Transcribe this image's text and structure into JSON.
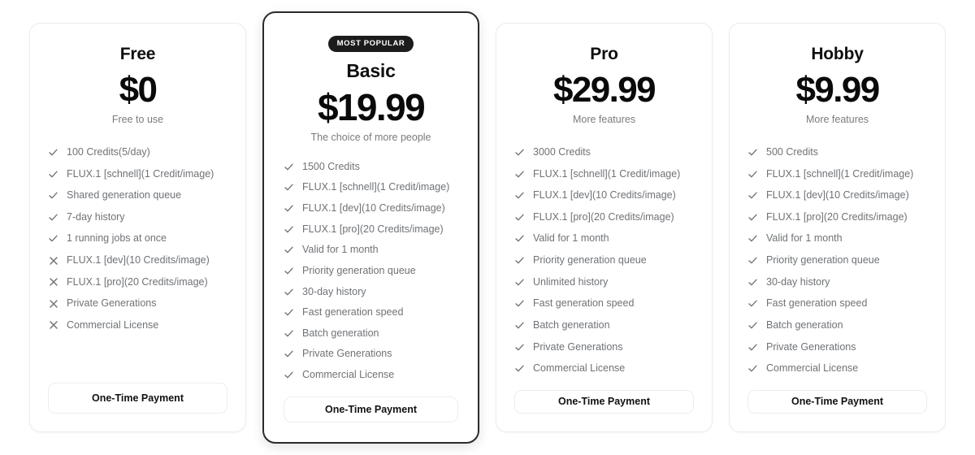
{
  "colors": {
    "badge_background": "#1c1c1c",
    "badge_text": "#ffffff",
    "featured_border": "#2b2b2b",
    "card_border": "#ececec",
    "price_text": "#0a0a0a",
    "feature_text": "#6f7276",
    "tagline_text": "#7b7b7b",
    "page_background": "#ffffff"
  },
  "plans": [
    {
      "name": "Free",
      "price": "$0",
      "tagline": "Free to use",
      "featured": false,
      "badge": "",
      "cta_label": "One-Time Payment",
      "features": [
        {
          "text": "100 Credits(5/day)",
          "included": true
        },
        {
          "text": "FLUX.1 [schnell](1 Credit/image)",
          "included": true
        },
        {
          "text": "Shared generation queue",
          "included": true
        },
        {
          "text": "7-day history",
          "included": true
        },
        {
          "text": "1 running jobs at once",
          "included": true
        },
        {
          "text": "FLUX.1 [dev](10 Credits/image)",
          "included": false
        },
        {
          "text": "FLUX.1 [pro](20 Credits/image)",
          "included": false
        },
        {
          "text": "Private Generations",
          "included": false
        },
        {
          "text": "Commercial License",
          "included": false
        }
      ]
    },
    {
      "name": "Basic",
      "price": "$19.99",
      "tagline": "The choice of more people",
      "featured": true,
      "badge": "MOST POPULAR",
      "cta_label": "One-Time Payment",
      "features": [
        {
          "text": "1500 Credits",
          "included": true
        },
        {
          "text": "FLUX.1 [schnell](1 Credit/image)",
          "included": true
        },
        {
          "text": "FLUX.1 [dev](10 Credits/image)",
          "included": true
        },
        {
          "text": "FLUX.1 [pro](20 Credits/image)",
          "included": true
        },
        {
          "text": "Valid for 1 month",
          "included": true
        },
        {
          "text": "Priority generation queue",
          "included": true
        },
        {
          "text": "30-day history",
          "included": true
        },
        {
          "text": "Fast generation speed",
          "included": true
        },
        {
          "text": "Batch generation",
          "included": true
        },
        {
          "text": "Private Generations",
          "included": true
        },
        {
          "text": "Commercial License",
          "included": true
        }
      ]
    },
    {
      "name": "Pro",
      "price": "$29.99",
      "tagline": "More features",
      "featured": false,
      "badge": "",
      "cta_label": "One-Time Payment",
      "features": [
        {
          "text": "3000 Credits",
          "included": true
        },
        {
          "text": "FLUX.1 [schnell](1 Credit/image)",
          "included": true
        },
        {
          "text": "FLUX.1 [dev](10 Credits/image)",
          "included": true
        },
        {
          "text": "FLUX.1 [pro](20 Credits/image)",
          "included": true
        },
        {
          "text": "Valid for 1 month",
          "included": true
        },
        {
          "text": "Priority generation queue",
          "included": true
        },
        {
          "text": "Unlimited history",
          "included": true
        },
        {
          "text": "Fast generation speed",
          "included": true
        },
        {
          "text": "Batch generation",
          "included": true
        },
        {
          "text": "Private Generations",
          "included": true
        },
        {
          "text": "Commercial License",
          "included": true
        }
      ]
    },
    {
      "name": "Hobby",
      "price": "$9.99",
      "tagline": "More features",
      "featured": false,
      "badge": "",
      "cta_label": "One-Time Payment",
      "features": [
        {
          "text": "500 Credits",
          "included": true
        },
        {
          "text": "FLUX.1 [schnell](1 Credit/image)",
          "included": true
        },
        {
          "text": "FLUX.1 [dev](10 Credits/image)",
          "included": true
        },
        {
          "text": "FLUX.1 [pro](20 Credits/image)",
          "included": true
        },
        {
          "text": "Valid for 1 month",
          "included": true
        },
        {
          "text": "Priority generation queue",
          "included": true
        },
        {
          "text": "30-day history",
          "included": true
        },
        {
          "text": "Fast generation speed",
          "included": true
        },
        {
          "text": "Batch generation",
          "included": true
        },
        {
          "text": "Private Generations",
          "included": true
        },
        {
          "text": "Commercial License",
          "included": true
        }
      ]
    }
  ],
  "icons": {
    "included": "check-icon",
    "excluded": "cross-icon"
  }
}
